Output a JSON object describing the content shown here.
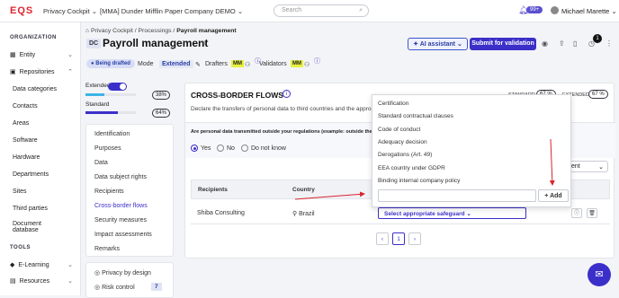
{
  "topbar": {
    "logo": "EQS",
    "app": "Privacy Cockpit",
    "company": "[MMA] Dunder Mifflin Paper Company DEMO",
    "search_placeholder": "Search",
    "notif_badge": "99+",
    "user": "Michael Marette"
  },
  "sidebar": {
    "org_heading": "ORGANIZATION",
    "entity": "Entity",
    "repositories": "Repositories",
    "items": [
      "Data categories",
      "Contacts",
      "Areas",
      "Software",
      "Hardware",
      "Departments",
      "Sites",
      "Third parties",
      "Document database"
    ],
    "tools_heading": "TOOLS",
    "elearning": "E-Learning",
    "resources": "Resources"
  },
  "breadcrumb": {
    "a": "Privacy Cockpit",
    "b": "Processings",
    "c": "Payroll management"
  },
  "header": {
    "code": "DC",
    "title": "Payroll management",
    "ai_btn": "AI assistant",
    "submit_btn": "Submit for validation",
    "count": "1"
  },
  "meta": {
    "status": "Being drafted",
    "mode_label": "Mode",
    "mode_value": "Extended",
    "drafters_label": "Drafters",
    "validators_label": "Validators",
    "initials": "MM"
  },
  "levels": {
    "extended": "Extended",
    "extended_pct": "38%",
    "extended_val": 38,
    "standard": "Standard",
    "standard_pct": "64%",
    "standard_val": 64
  },
  "nav": [
    "Identification",
    "Purposes",
    "Data",
    "Data subject rights",
    "Recipients",
    "Cross-border flows",
    "Security measures",
    "Impact assessments",
    "Remarks"
  ],
  "bottom": {
    "privacy": "Privacy by design",
    "risk": "Risk control",
    "risk_count": "7"
  },
  "card": {
    "title": "CROSS-BORDER FLOWS",
    "standard_label": "STANDARD",
    "standard_pct": "67 %",
    "extended_label": "EXTENDED",
    "extended_pct": "67 %",
    "desc": "Declare the transfers of personal data to third countries and the appropria",
    "question": "Are personal data transmitted outside your regulations (example: outside the Europea",
    "yes": "Yes",
    "no": "No",
    "dont_know": "Do not know",
    "sort_btn": "ent",
    "col_recipients": "Recipients",
    "col_country": "Country",
    "row_recipient": "Shiba Consulting",
    "row_country": "Brazil",
    "safeguard": "Select appropriate safeguard",
    "page": "1"
  },
  "dropdown": {
    "options": [
      "Certification",
      "Standard contractual clauses",
      "Code of conduct",
      "Adequacy decision",
      "Derogations (Art. 49)",
      "EEA country under GDPR",
      "Binding internal company policy"
    ],
    "add": "Add"
  },
  "colors": {
    "brand": "#e0232e",
    "accent": "#3b2fc9",
    "arrow": "#d9232e"
  }
}
